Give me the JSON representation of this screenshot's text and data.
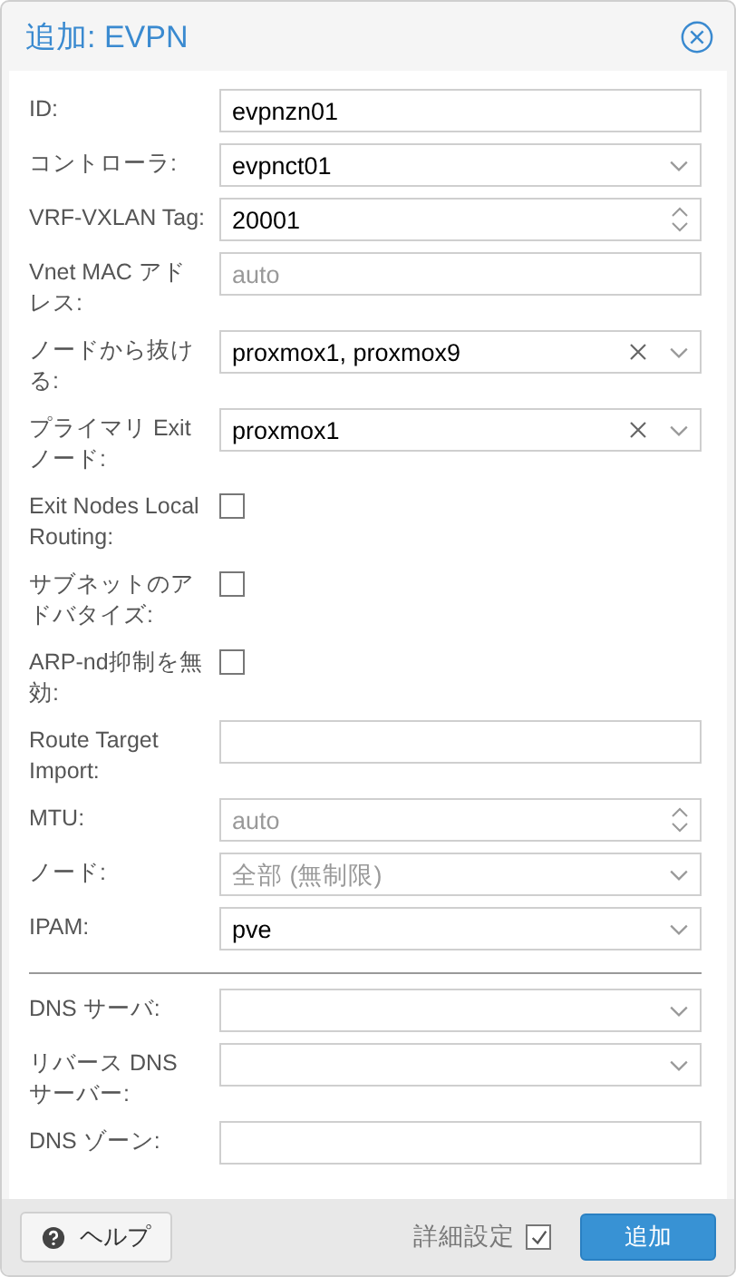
{
  "window": {
    "title": "追加: EVPN"
  },
  "sections": [
    {
      "fields": [
        {
          "label": "ID:",
          "kind": "text",
          "value": "evpnzn01"
        },
        {
          "label": "コントローラ:",
          "kind": "combo",
          "value": "evpnct01",
          "clearable": false
        },
        {
          "label": "VRF-VXLAN Tag:",
          "kind": "number",
          "value": "20001"
        },
        {
          "label": "Vnet MAC アドレス:",
          "kind": "text",
          "placeholder": "auto"
        },
        {
          "label": "ノードから抜ける:",
          "kind": "combo",
          "value": "proxmox1, proxmox9",
          "clearable": true
        },
        {
          "label": "プライマリ Exit ノード:",
          "kind": "combo",
          "value": "proxmox1",
          "clearable": true
        },
        {
          "label": "Exit Nodes Local Routing:",
          "kind": "checkbox",
          "checked": false
        },
        {
          "label": "サブネットのアドバタイズ:",
          "kind": "checkbox",
          "checked": false
        },
        {
          "label": "ARP-nd抑制を無効:",
          "kind": "checkbox",
          "checked": false
        },
        {
          "label": "Route Target Import:",
          "kind": "text"
        },
        {
          "label": "MTU:",
          "kind": "number",
          "placeholder": "auto"
        },
        {
          "label": "ノード:",
          "kind": "combo",
          "placeholder": "全部 (無制限)",
          "clearable": false
        },
        {
          "label": "IPAM:",
          "kind": "combo",
          "value": "pve",
          "clearable": false
        }
      ]
    },
    {
      "fields": [
        {
          "label": "DNS サーバ:",
          "kind": "combo",
          "clearable": false
        },
        {
          "label": "リバース DNS サーバー:",
          "kind": "combo",
          "clearable": false
        },
        {
          "label": "DNS ゾーン:",
          "kind": "text"
        }
      ]
    }
  ],
  "footer": {
    "help_button": "ヘルプ",
    "advanced": {
      "label": "詳細設定",
      "checked": true
    },
    "submit_button": "追加"
  }
}
